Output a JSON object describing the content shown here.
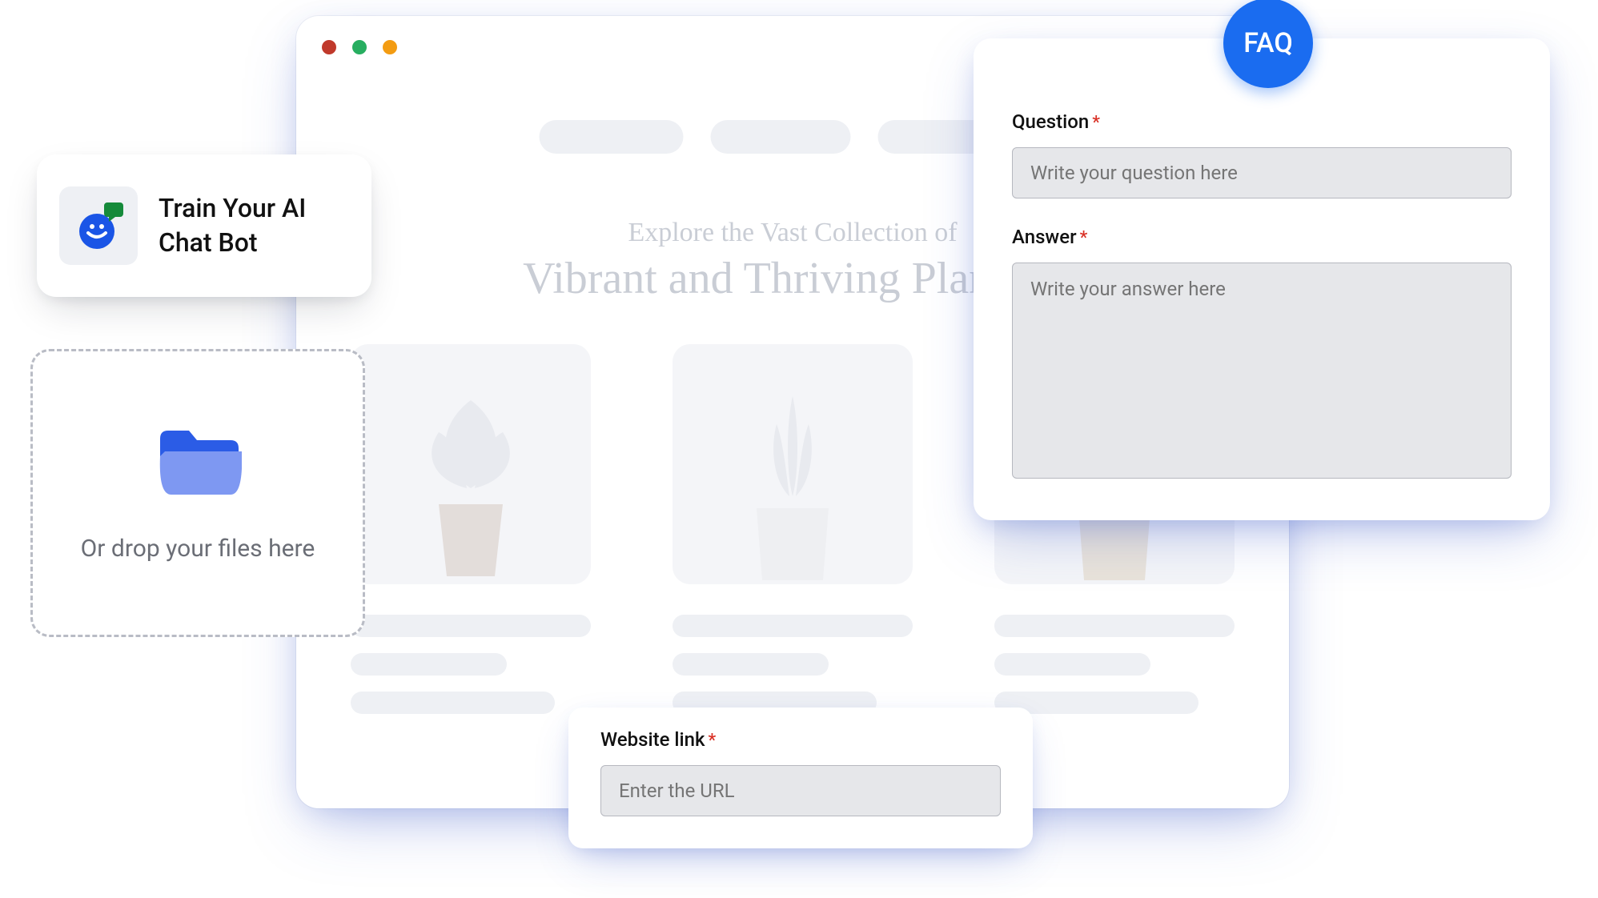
{
  "browser": {
    "hero_line1": "Explore the Vast Collection of",
    "hero_line2": "Vibrant and Thriving Plants C"
  },
  "train_card": {
    "title_line1": "Train Your AI",
    "title_line2": "Chat Bot"
  },
  "drop_card": {
    "label": "Or drop your files here"
  },
  "link_card": {
    "label": "Website link",
    "placeholder": "Enter the URL"
  },
  "faq_card": {
    "badge": "FAQ",
    "question_label": "Question",
    "question_placeholder": "Write your question here",
    "answer_label": "Answer",
    "answer_placeholder": "Write your answer here"
  },
  "required_marker": "*"
}
